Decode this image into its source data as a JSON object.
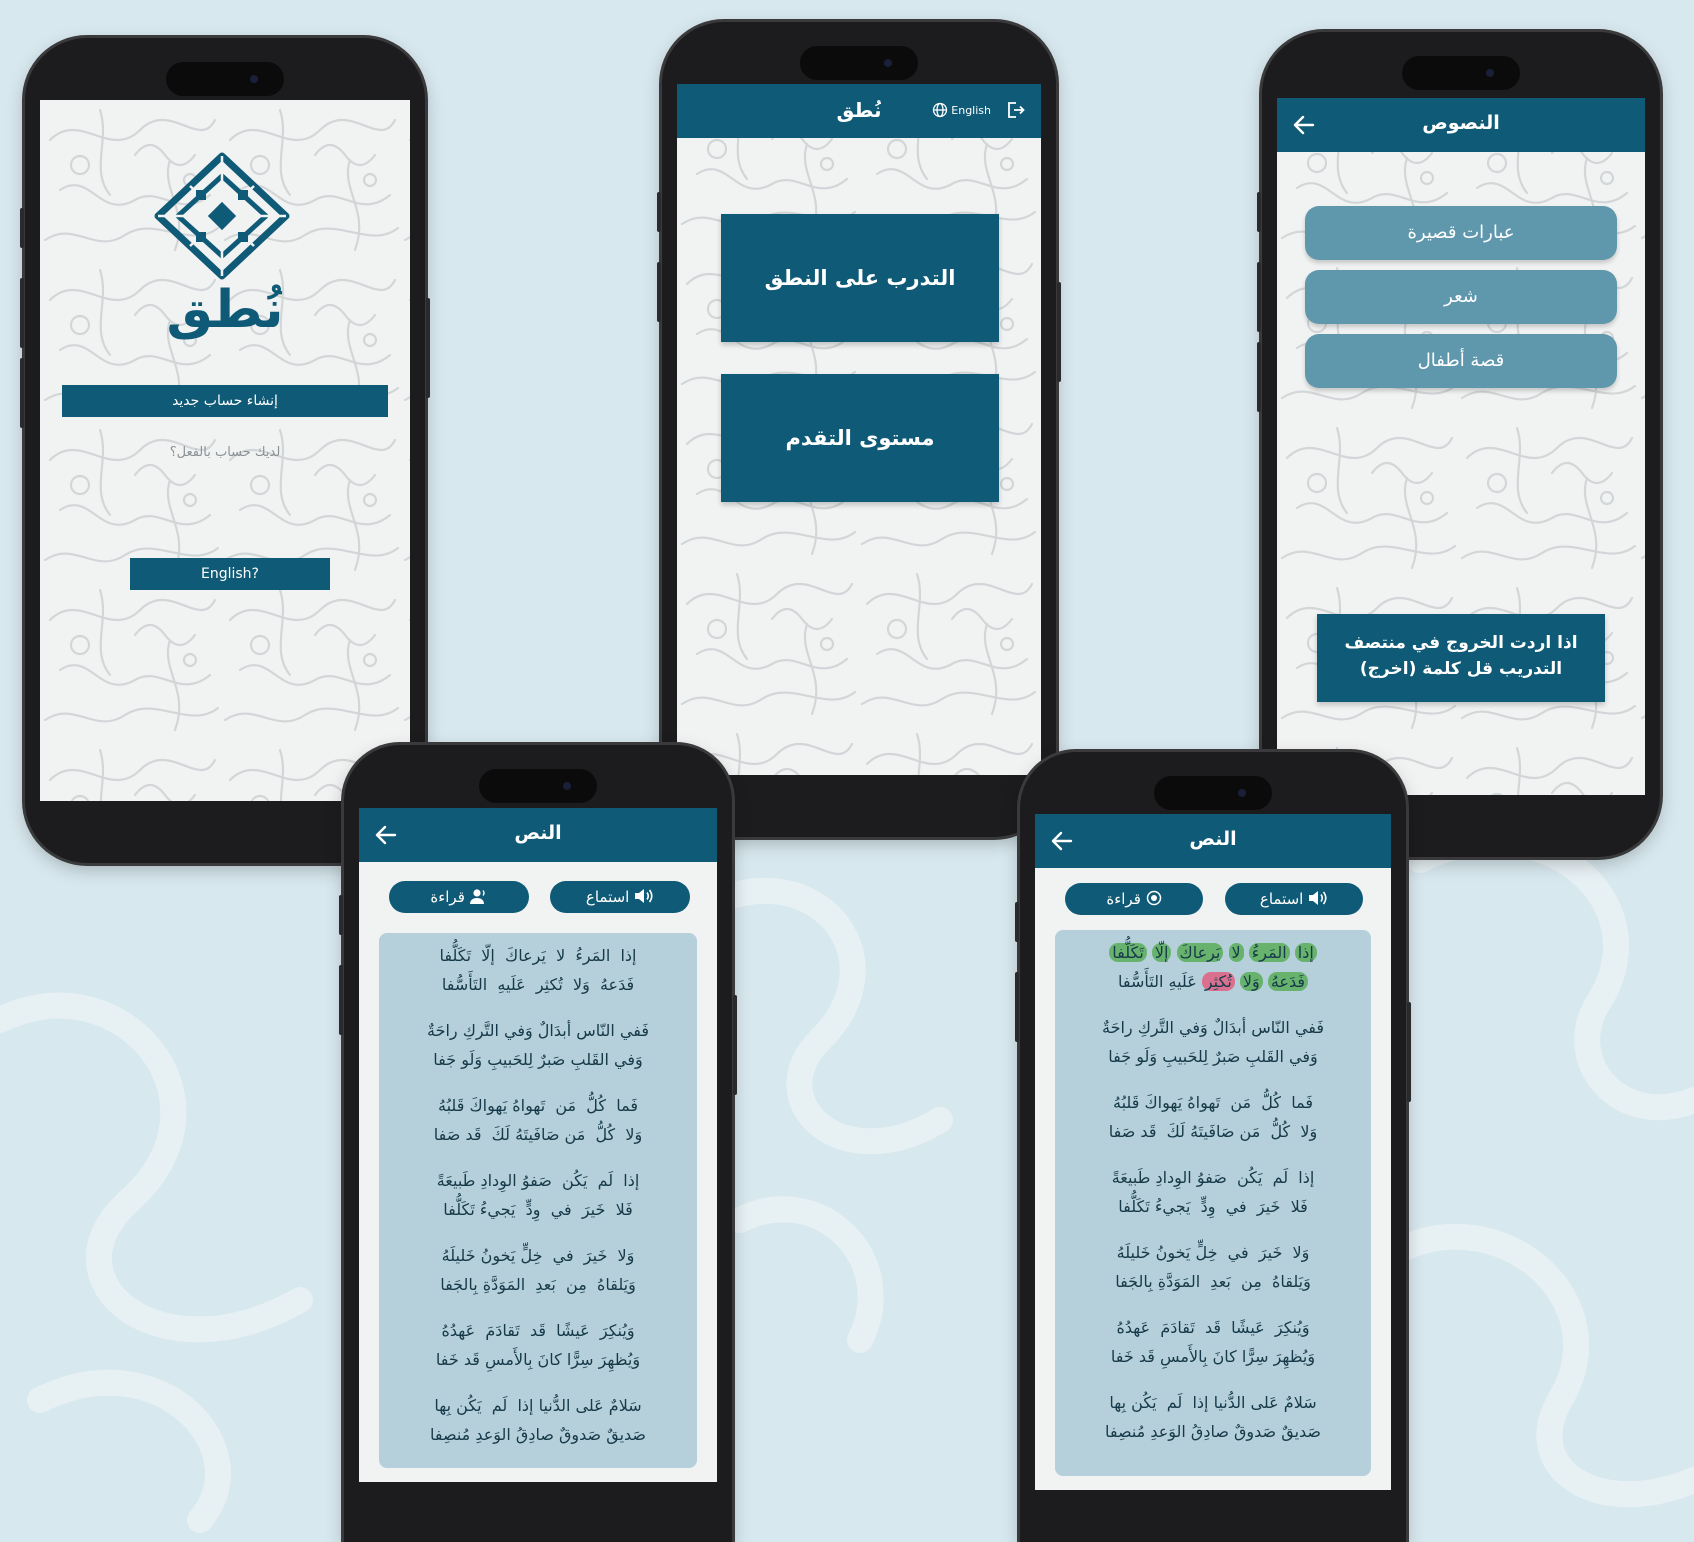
{
  "screens": {
    "welcome": {
      "app_name": "نُطق",
      "create_account": "إنشاء حساب جديد",
      "have_account": "لديك حساب بالفعل؟",
      "english_button": "English?"
    },
    "home": {
      "app_name": "نُطق",
      "language_label": "English",
      "practice_button": "التدرب على النطق",
      "progress_button": "مستوى التقدم"
    },
    "texts": {
      "title": "النصوص",
      "categories": [
        "عبارات قصيرة",
        "شعر",
        "قصة أطفال"
      ],
      "exit_hint_line1": "اذا اردت الخروج في منتصف",
      "exit_hint_line2": "التدريب قل كلمة (اخرج)"
    },
    "poem_listen": {
      "title": "النص",
      "read_label": "قراءة",
      "listen_label": "استماع"
    },
    "poem_reading": {
      "title": "النص",
      "read_label": "قراءة",
      "listen_label": "استماع",
      "first_stanza": {
        "line1": [
          "إذا",
          "المَرءُ",
          "لا",
          "يَرعاكَ",
          "إلّا",
          "تَكَلُّفا"
        ],
        "line1_status": [
          "correct",
          "correct",
          "correct",
          "correct",
          "correct",
          "correct"
        ],
        "line2": [
          "فَدَعهُ",
          "وَلا",
          "تُكثِر",
          "عَلَيهِ",
          "التَأَسُّفا"
        ],
        "line2_status": [
          "correct",
          "correct",
          "wrong",
          "none",
          "none"
        ]
      }
    }
  },
  "poem": [
    [
      "إذا  المَرءُ  لا  يَرعاكَ  إلّا  تَكَلُّفا",
      "فَدَعهُ  وَلا  تُكثِر  عَلَيهِ  التَأَسُّفا"
    ],
    [
      "فَفي النّاس أبدَالٌ وَفي التَّركِ راحَةٌ",
      "وَفي القَلبِ صَبرٌ لِلحَبيبِ وَلَو جَفا"
    ],
    [
      "فَما  كُلُّ  مَن  تَهواهُ يَهواكَ قَلبُهُ",
      "وَلا  كُلُّ  مَن صَافَيتَهُ لَكَ  قَد صَفا"
    ],
    [
      "إذا  لَم  يَكُن  صَفوُ الوِدادِ طَبيعَةً",
      "فَلا  خَيرَ  في  وِدٍّ  يَجيءُ تَكَلُّفا"
    ],
    [
      "وَلا  خَيرَ  في  خِلٍّ يَخونُ خَليلَهُ",
      "وَيَلقاهُ  مِن  بَعدِ  المَوَدَّةِ بِالجَفا"
    ],
    [
      "وَيُنكِرَ  عَيشًا  قَد  تَقادَمَ  عَهدُهُ",
      "وَيُظهِرَ سِرًّا كانَ بِالأَمسِ قَد خَفا"
    ],
    [
      "سَلامٌ عَلى الدُّنيا إذا  لَم  يَكُن بِها",
      "صَديقٌ صَدوقٌ صادِقُ الوَعدِ مُنصِفا"
    ]
  ],
  "colors": {
    "primary": "#0f5a76",
    "light_button": "#5f98ad",
    "poem_card": "#b5d0da",
    "correct_word": "#67b36d",
    "wrong_word": "#d9708f",
    "page_background": "#d7e8ee"
  },
  "icons": [
    "nutq-logo",
    "globe-icon",
    "logout-icon",
    "back-arrow-icon",
    "user-voice-icon",
    "speaker-icon",
    "record-icon"
  ]
}
